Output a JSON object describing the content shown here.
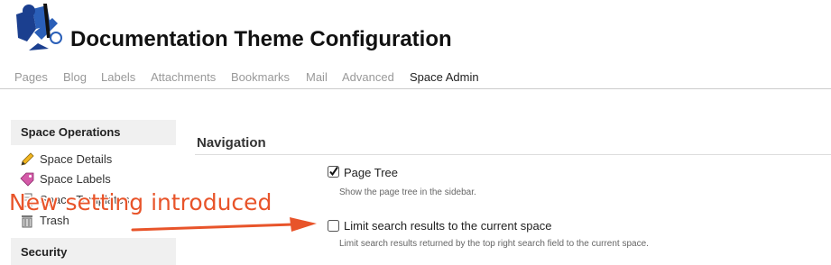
{
  "header": {
    "title": "Documentation Theme Configuration",
    "logo_icon": "confluence-logo"
  },
  "tabs": [
    {
      "label": "Pages",
      "active": false
    },
    {
      "label": "Blog",
      "active": false
    },
    {
      "label": "Labels",
      "active": false
    },
    {
      "label": "Attachments",
      "active": false
    },
    {
      "label": "Bookmarks",
      "active": false
    },
    {
      "label": "Mail",
      "active": false
    },
    {
      "label": "Advanced",
      "active": false
    },
    {
      "label": "Space Admin",
      "active": true
    }
  ],
  "sidebar": {
    "section_operations": "Space Operations",
    "items": [
      {
        "label": "Space Details",
        "icon": "pencil-icon"
      },
      {
        "label": "Space Labels",
        "icon": "tag-icon"
      },
      {
        "label": "Space Templates",
        "icon": "template-icon"
      },
      {
        "label": "Trash",
        "icon": "trash-icon"
      }
    ],
    "section_security": "Security"
  },
  "main": {
    "section_title": "Navigation",
    "options": [
      {
        "label": "Page Tree",
        "description": "Show the page tree in the sidebar.",
        "checked": true
      },
      {
        "label": "Limit search results to the current space",
        "description": "Limit search results returned by the top right search field to the current space.",
        "checked": false
      }
    ]
  },
  "annotation": {
    "text": "New setting introduced",
    "color": "#e8542a"
  },
  "colors": {
    "tab_inactive": "#999999",
    "tab_active": "#222222",
    "sidebar_bg": "#f0f0f0"
  }
}
